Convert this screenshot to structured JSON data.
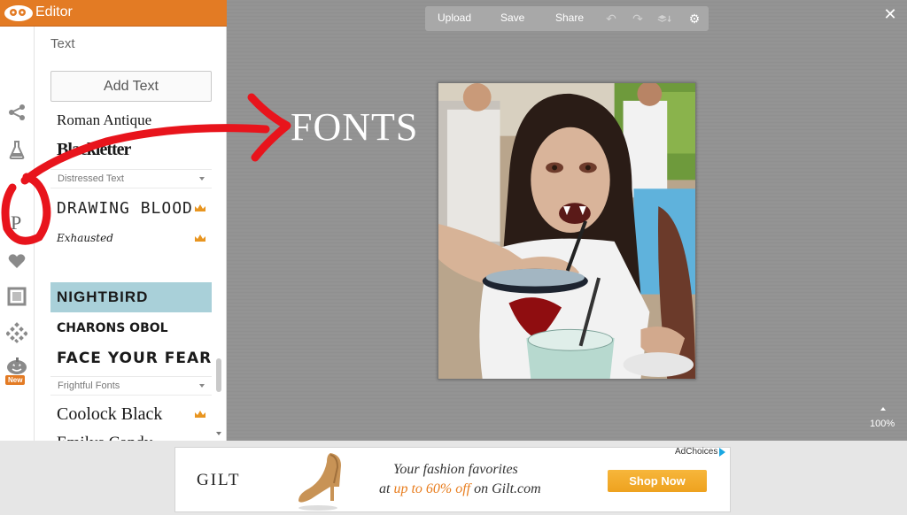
{
  "header": {
    "title": "Editor"
  },
  "panel": {
    "title": "Text",
    "add_text": "Add Text",
    "fonts": [
      {
        "label": "Roman Antique",
        "selected": false
      },
      {
        "label": "Blackletter",
        "selected": false
      },
      {
        "group": "Distressed Text"
      },
      {
        "label": "DRAWING BLOOD",
        "premium": true
      },
      {
        "label": "Exhausted",
        "premium": true
      },
      {
        "label": "NIGHTBIRD",
        "selected": true
      },
      {
        "label": "CHARONS OBOL"
      },
      {
        "label": "FACE YOUR FEARS"
      },
      {
        "group": "Frightful Fonts"
      },
      {
        "label": "Coolock Black",
        "premium": true
      },
      {
        "label": "Emilys Candy"
      }
    ],
    "new_badge": "New"
  },
  "toolbar": {
    "upload": "Upload",
    "save": "Save",
    "share": "Share"
  },
  "canvas": {
    "overlay_text": "FONTS",
    "zoom": "100%"
  },
  "ad": {
    "brand": "GILT",
    "line1": "Your fashion favorites",
    "line2_pre": "at ",
    "line2_hl": "up to 60% off",
    "line2_post": " on Gilt.com",
    "button": "Shop Now",
    "adchoices": "AdChoices"
  },
  "colors": {
    "brand": "#e37b24",
    "selected_row": "#a9d0d9",
    "annotation": "#e8141c",
    "ad_button": "#eea21f"
  },
  "icons": [
    "pikmonkey-logo-icon",
    "nodes-icon",
    "flask-icon",
    "text-p-icon",
    "hearts-icon",
    "frame-icon",
    "texture-icon",
    "pumpkin-icon",
    "undo-icon",
    "redo-icon",
    "layers-icon",
    "gear-icon",
    "close-icon",
    "crown-icon"
  ]
}
